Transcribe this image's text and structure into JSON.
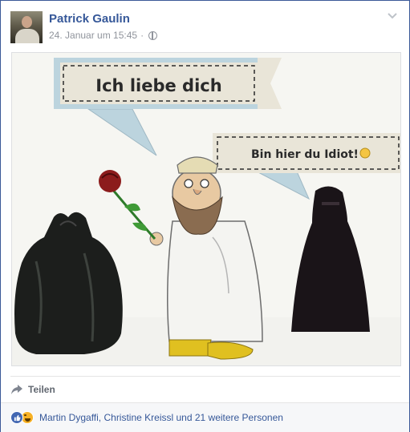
{
  "post": {
    "author": "Patrick Gaulin",
    "date": "24. Januar um 15:45",
    "separator": "·",
    "privacy_icon": "globe-icon",
    "options_icon": "chevron-down-icon"
  },
  "image": {
    "bubble_left": "Ich liebe dich",
    "bubble_right": "Bin hier du Idiot!"
  },
  "actions": {
    "share_label": "Teilen",
    "share_icon": "share-arrow-icon"
  },
  "reactions": {
    "icons": [
      "like-icon",
      "haha-icon"
    ],
    "summary": "Martin Dygaffi, Christine Kreissl und 21 weitere Personen"
  },
  "colors": {
    "brand": "#3b5998",
    "link": "#365899",
    "meta": "#90949c"
  }
}
